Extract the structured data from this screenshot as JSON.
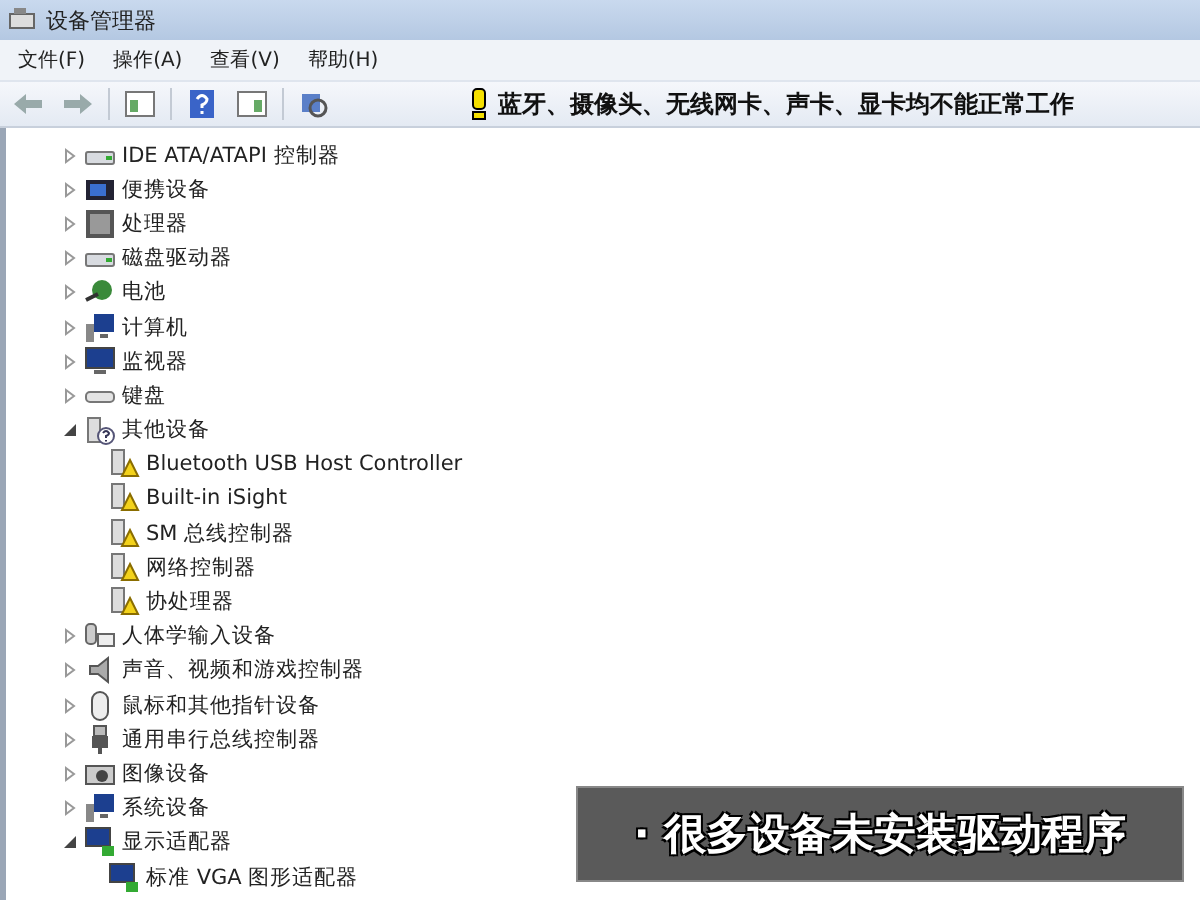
{
  "window": {
    "title": "设备管理器"
  },
  "menu": [
    "文件(F)",
    "操作(A)",
    "查看(V)",
    "帮助(H)"
  ],
  "toolbar": {
    "note": "蓝牙、摄像头、无线网卡、声卡、显卡均不能正常工作"
  },
  "tree": [
    {
      "label": "IDE ATA/ATAPI 控制器",
      "kind": "drive",
      "expanded": false
    },
    {
      "label": "便携设备",
      "kind": "portable",
      "expanded": false
    },
    {
      "label": "处理器",
      "kind": "cpu",
      "expanded": false
    },
    {
      "label": "磁盘驱动器",
      "kind": "drive",
      "expanded": false
    },
    {
      "label": "电池",
      "kind": "battery",
      "expanded": false
    },
    {
      "label": "计算机",
      "kind": "computer",
      "expanded": false
    },
    {
      "label": "监视器",
      "kind": "monitor",
      "expanded": false
    },
    {
      "label": "键盘",
      "kind": "keyboard",
      "expanded": false
    },
    {
      "label": "其他设备",
      "kind": "other",
      "expanded": true,
      "children": [
        {
          "label": "Bluetooth USB Host Controller",
          "kind": "unknown"
        },
        {
          "label": "Built-in iSight",
          "kind": "unknown"
        },
        {
          "label": "SM 总线控制器",
          "kind": "unknown"
        },
        {
          "label": "网络控制器",
          "kind": "unknown"
        },
        {
          "label": "协处理器",
          "kind": "unknown"
        }
      ]
    },
    {
      "label": "人体学输入设备",
      "kind": "hid",
      "expanded": false
    },
    {
      "label": "声音、视频和游戏控制器",
      "kind": "sound",
      "expanded": false
    },
    {
      "label": "鼠标和其他指针设备",
      "kind": "mouse",
      "expanded": false
    },
    {
      "label": "通用串行总线控制器",
      "kind": "usb",
      "expanded": false
    },
    {
      "label": "图像设备",
      "kind": "imaging",
      "expanded": false
    },
    {
      "label": "系统设备",
      "kind": "computer",
      "expanded": false
    },
    {
      "label": "显示适配器",
      "kind": "display",
      "expanded": true,
      "children": [
        {
          "label": "标准 VGA 图形适配器",
          "kind": "display"
        }
      ]
    }
  ],
  "caption": "· 很多设备未安装驱动程序"
}
